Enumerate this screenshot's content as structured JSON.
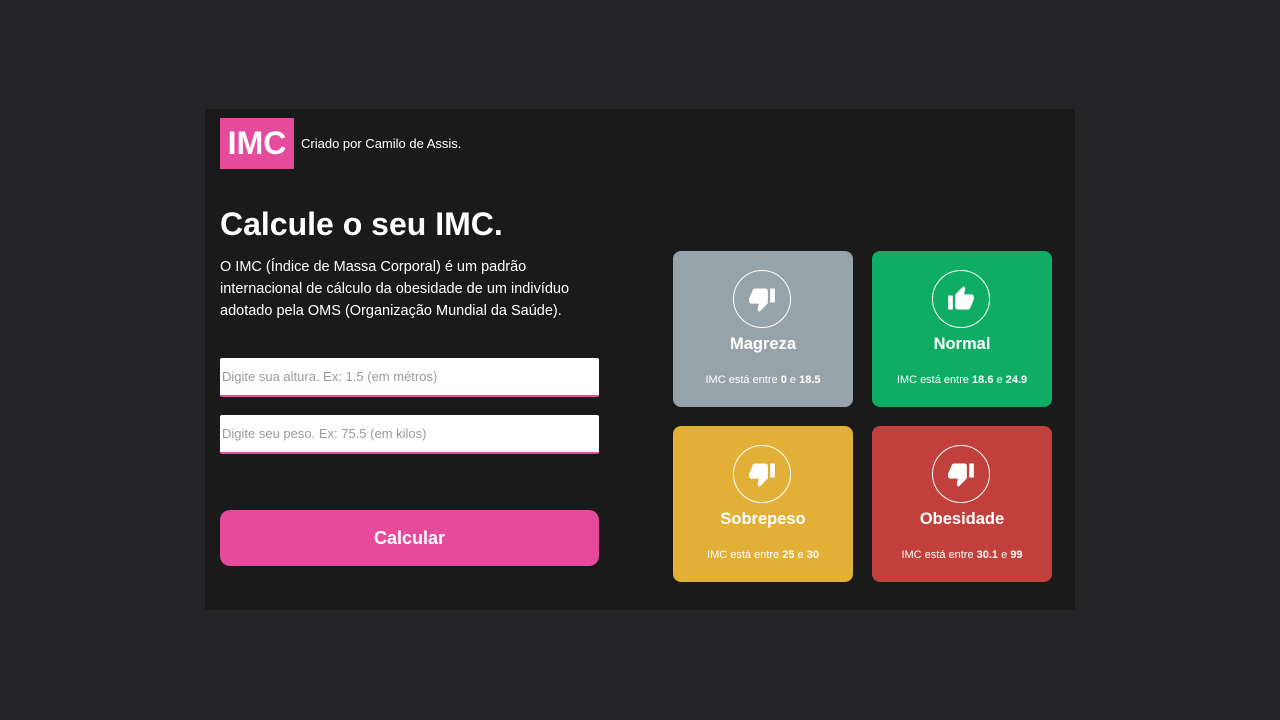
{
  "header": {
    "logo": "IMC",
    "credit": "Criado por Camilo de Assis."
  },
  "main": {
    "title": "Calcule o seu IMC.",
    "description": "O IMC (Índice de Massa Corporal) é um padrão internacional de cálculo da obesidade de um indivíduo adotado pela OMS (Organização Mundial da Saúde)."
  },
  "form": {
    "height_placeholder": "Digite sua altura. Ex: 1.5 (em métros)",
    "weight_placeholder": "Digite seu peso. Ex: 75.5 (em kilos)",
    "calculate_label": "Calcular"
  },
  "cards": [
    {
      "name": "Magreza",
      "icon": "thumbs-down-icon",
      "prefix": "IMC está entre",
      "min": "0",
      "sep": "e",
      "max": "18.5",
      "color": "#97a3aa"
    },
    {
      "name": "Normal",
      "icon": "thumbs-up-icon",
      "prefix": "IMC está entre",
      "min": "18.6",
      "sep": "e",
      "max": "24.9",
      "color": "#0fad63"
    },
    {
      "name": "Sobrepeso",
      "icon": "thumbs-down-icon",
      "prefix": "IMC está entre",
      "min": "25",
      "sep": "e",
      "max": "30",
      "color": "#e2b037"
    },
    {
      "name": "Obesidade",
      "icon": "thumbs-down-icon",
      "prefix": "IMC está entre",
      "min": "30.1",
      "sep": "e",
      "max": "99",
      "color": "#c2403c"
    }
  ],
  "colors": {
    "accent": "#e64a9b",
    "background": "#252527",
    "panel": "#1a1a1b"
  }
}
